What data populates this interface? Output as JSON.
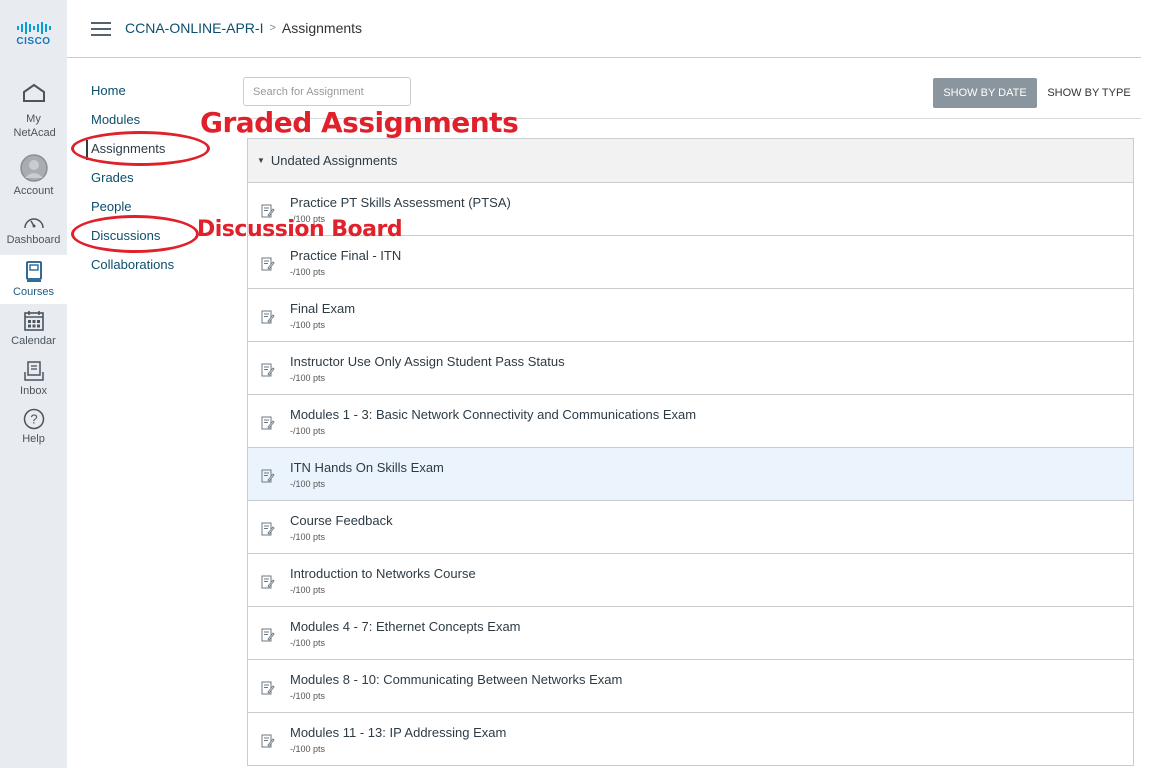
{
  "global_nav": {
    "logo_text": "CISCO",
    "items": [
      {
        "label": "My NetAcad",
        "icon": "home-icon"
      },
      {
        "label": "Account",
        "icon": "avatar-icon"
      },
      {
        "label": "Dashboard",
        "icon": "dashboard-icon"
      },
      {
        "label": "Courses",
        "icon": "courses-icon",
        "active": true
      },
      {
        "label": "Calendar",
        "icon": "calendar-icon"
      },
      {
        "label": "Inbox",
        "icon": "inbox-icon"
      },
      {
        "label": "Help",
        "icon": "help-icon"
      }
    ]
  },
  "header": {
    "course": "CCNA-ONLINE-APR-I",
    "separator": ">",
    "current": "Assignments"
  },
  "course_nav": {
    "items": [
      "Home",
      "Modules",
      "Assignments",
      "Grades",
      "People",
      "Discussions",
      "Collaborations"
    ],
    "active": "Assignments"
  },
  "toolbar": {
    "search_placeholder": "Search for Assignment",
    "show_by_date": "SHOW BY DATE",
    "show_by_type": "SHOW BY TYPE"
  },
  "group": {
    "title": "Undated Assignments",
    "assignments": [
      {
        "title": "Practice PT Skills Assessment (PTSA)",
        "points": "-/100 pts"
      },
      {
        "title": "Practice Final - ITN",
        "points": "-/100 pts"
      },
      {
        "title": "Final Exam",
        "points": "-/100 pts"
      },
      {
        "title": "Instructor Use Only Assign Student Pass Status",
        "points": "-/100 pts"
      },
      {
        "title": "Modules 1 - 3: Basic Network Connectivity and Communications Exam",
        "points": "-/100 pts"
      },
      {
        "title": "ITN Hands On Skills Exam",
        "points": "-/100 pts",
        "highlighted": true
      },
      {
        "title": "Course Feedback",
        "points": "-/100 pts"
      },
      {
        "title": "Introduction to Networks Course",
        "points": "-/100 pts"
      },
      {
        "title": "Modules 4 - 7: Ethernet Concepts Exam",
        "points": "-/100 pts"
      },
      {
        "title": "Modules 8 - 10: Communicating Between Networks Exam",
        "points": "-/100 pts"
      },
      {
        "title": "Modules 11 - 13: IP Addressing Exam",
        "points": "-/100 pts"
      }
    ]
  },
  "annotations": {
    "graded": "Graded Assignments",
    "discussion": "Discussion Board",
    "color": "#e0202a"
  }
}
